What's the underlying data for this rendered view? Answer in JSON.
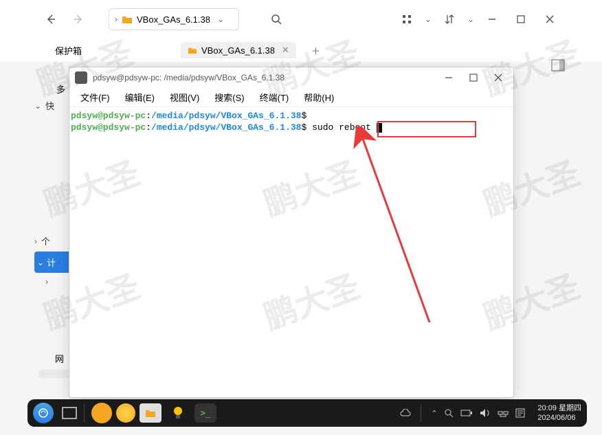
{
  "watermark": "鹏大圣",
  "fm": {
    "address": "VBox_GAs_6.1.38",
    "tab_multi": "多",
    "tab_safe": "保护箱",
    "tab_vbox": "VBox_GAs_6.1.38",
    "side_quick": "快",
    "side_personal": "个",
    "side_computer": "计",
    "side_network": "网"
  },
  "terminal": {
    "title": "pdsyw@pdsyw-pc: /media/pdsyw/VBox_GAs_6.1.38",
    "menus": {
      "file": "文件(F)",
      "edit": "编辑(E)",
      "view": "视图(V)",
      "search": "搜索(S)",
      "term": "终端(T)",
      "help": "帮助(H)"
    },
    "prompt_user": "pdsyw@pdsyw-pc",
    "prompt_colon": ":",
    "prompt_path": "/media/pdsyw/VBox_GAs_6.1.38",
    "prompt_dollar": "$",
    "command": "sudo reboot"
  },
  "taskbar": {
    "time": "20:09 星期四",
    "date": "2024/06/06",
    "term_glyph": ">_"
  }
}
